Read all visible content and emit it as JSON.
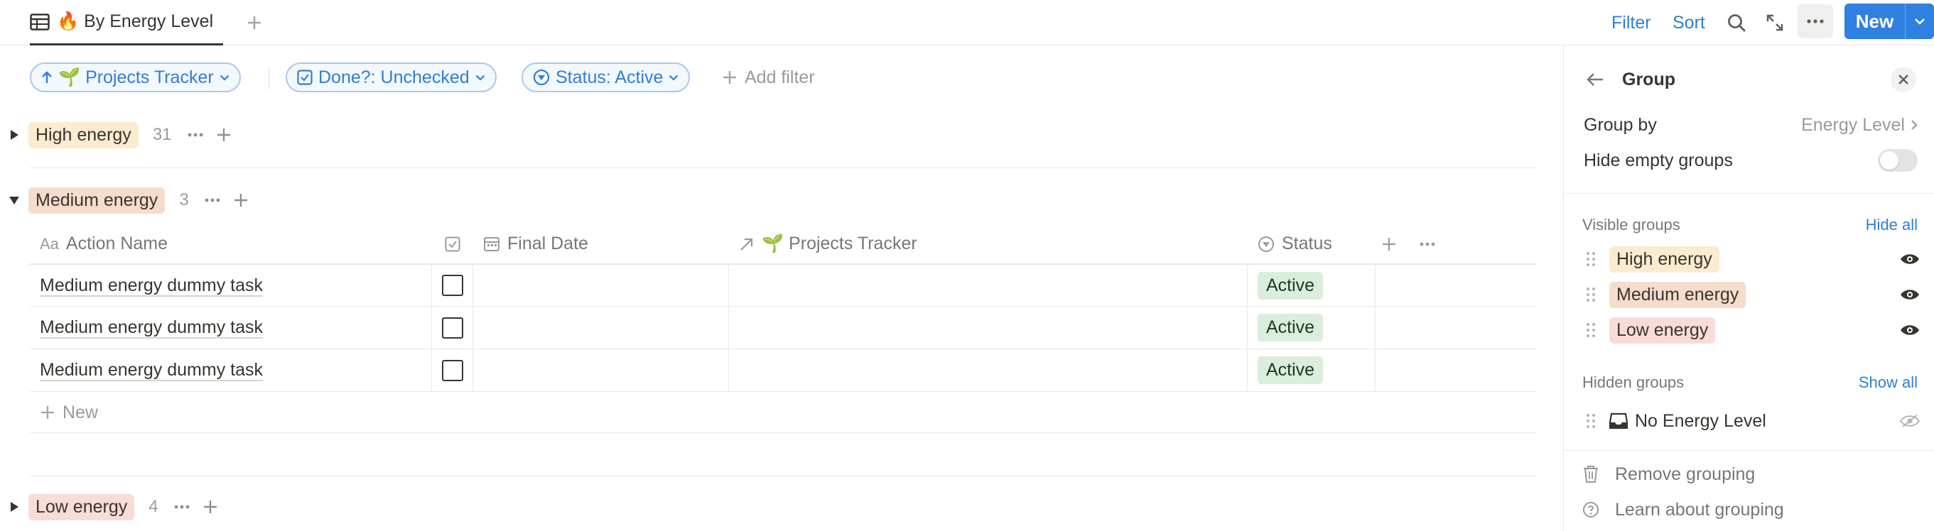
{
  "view_tab": {
    "label": "🔥 By Energy Level"
  },
  "toolbar": {
    "filter": "Filter",
    "sort": "Sort",
    "new": "New"
  },
  "filters": {
    "sort_chip": "🌱 Projects Tracker",
    "done_chip": "Done?: Unchecked",
    "status_chip": "Status: Active",
    "add_filter": "Add filter"
  },
  "groups": {
    "high": {
      "label": "High energy",
      "count": "31"
    },
    "medium": {
      "label": "Medium energy",
      "count": "3"
    },
    "low": {
      "label": "Low energy",
      "count": "4"
    }
  },
  "table": {
    "columns": {
      "name": "Action Name",
      "final_date": "Final Date",
      "projects": "🌱 Projects Tracker",
      "status": "Status"
    },
    "rows": [
      {
        "name": "Medium energy dummy task",
        "status": "Active"
      },
      {
        "name": "Medium energy dummy task",
        "status": "Active"
      },
      {
        "name": "Medium energy dummy task",
        "status": "Active"
      }
    ],
    "new_row": "New"
  },
  "panel": {
    "title": "Group",
    "group_by_label": "Group by",
    "group_by_value": "Energy Level",
    "hide_empty_label": "Hide empty groups",
    "visible_label": "Visible groups",
    "hide_all": "Hide all",
    "visible_groups": [
      "High energy",
      "Medium energy",
      "Low energy"
    ],
    "hidden_label": "Hidden groups",
    "show_all": "Show all",
    "hidden_groups": [
      "No Energy Level"
    ],
    "remove_grouping": "Remove grouping",
    "learn": "Learn about grouping"
  },
  "colors": {
    "accent": "#2f80e0",
    "high": "#fbecd0",
    "medium": "#f6dccb",
    "low": "#f9dcd8",
    "status_active": "#dbeddb"
  }
}
